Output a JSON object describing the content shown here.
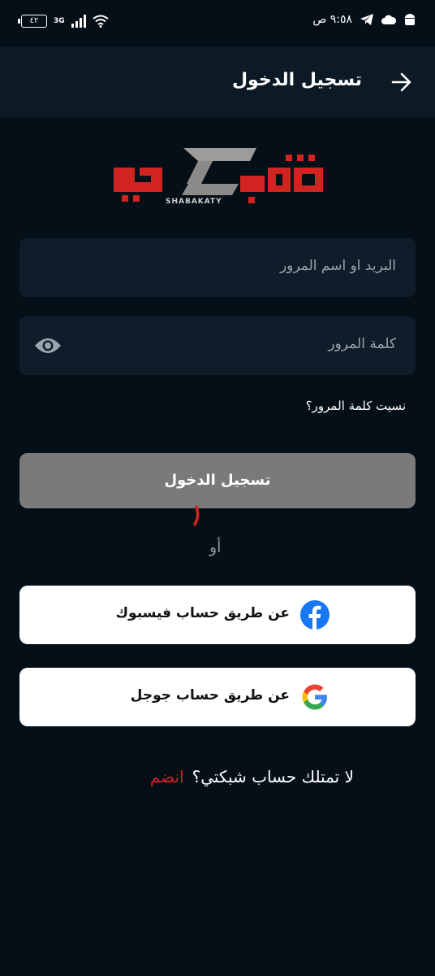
{
  "status_bar": {
    "time": "٩:٥٨ ص",
    "battery": "٤٢",
    "network": "3G"
  },
  "header": {
    "title": "تسجيل الدخول",
    "back_icon": "arrow-right-icon"
  },
  "logo": {
    "text_ar": "شبكتي",
    "text_en": "SHABAKATY"
  },
  "form": {
    "email_placeholder": "البريد او اسم المرور",
    "password_placeholder": "كلمة المرور",
    "forgot_label": "نسيت كلمة المرور؟",
    "login_label": "تسجيل الدخول",
    "or_label": "أو"
  },
  "social": {
    "facebook_label": "عن طريق حساب فيسبوك",
    "google_label": "عن طريق حساب جوجل"
  },
  "footer": {
    "no_account_text": "لا تمتلك حساب شبكتي؟",
    "join_label": "انضم"
  },
  "colors": {
    "background": "#050f18",
    "field": "#0f1d2a",
    "brand_red": "#d1231f",
    "facebook_blue": "#1877f2"
  }
}
